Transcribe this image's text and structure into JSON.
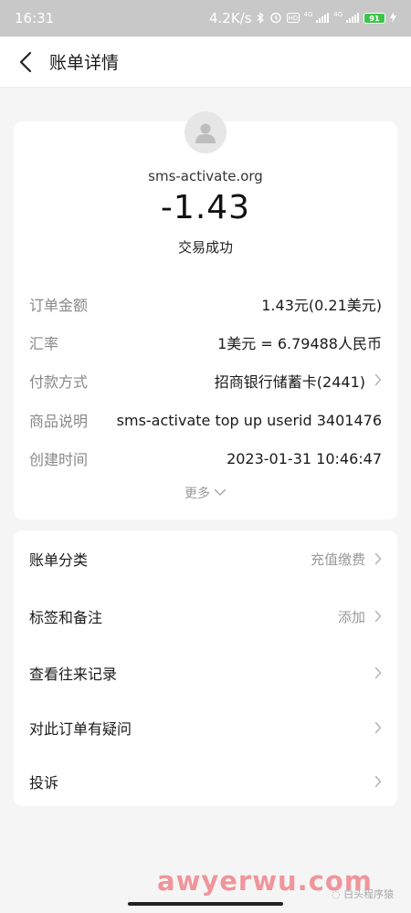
{
  "status_bar": {
    "time": "16:31",
    "speed": "4.2K/s",
    "signal1": "4G",
    "signal2": "4G",
    "battery": "91"
  },
  "nav": {
    "title": "账单详情"
  },
  "summary": {
    "merchant": "sms-activate.org",
    "amount": "-1.43",
    "status": "交易成功"
  },
  "details": [
    {
      "label": "订单金额",
      "value": "1.43元(0.21美元)"
    },
    {
      "label": "汇率",
      "value": "1美元 = 6.79488人民币"
    },
    {
      "label": "付款方式",
      "value": "招商银行储蓄卡(2441)"
    },
    {
      "label": "商品说明",
      "value": "sms-activate top up userid 3401476"
    },
    {
      "label": "创建时间",
      "value": "2023-01-31 10:46:47"
    }
  ],
  "more_label": "更多",
  "menu": [
    {
      "label": "账单分类",
      "value": "充值缴费"
    },
    {
      "label": "标签和备注",
      "value": "添加"
    },
    {
      "label": "查看往来记录",
      "value": ""
    },
    {
      "label": "对此订单有疑问",
      "value": ""
    },
    {
      "label": "投诉",
      "value": ""
    }
  ],
  "watermark": {
    "site": "awyerwu.com",
    "account": "白头程序猿"
  },
  "colors": {
    "status_bar_bg": "#c8c8c8",
    "page_bg": "#f5f5f5",
    "card_bg": "#ffffff",
    "label_gray": "#888888",
    "battery_green": "#3bc64a"
  }
}
